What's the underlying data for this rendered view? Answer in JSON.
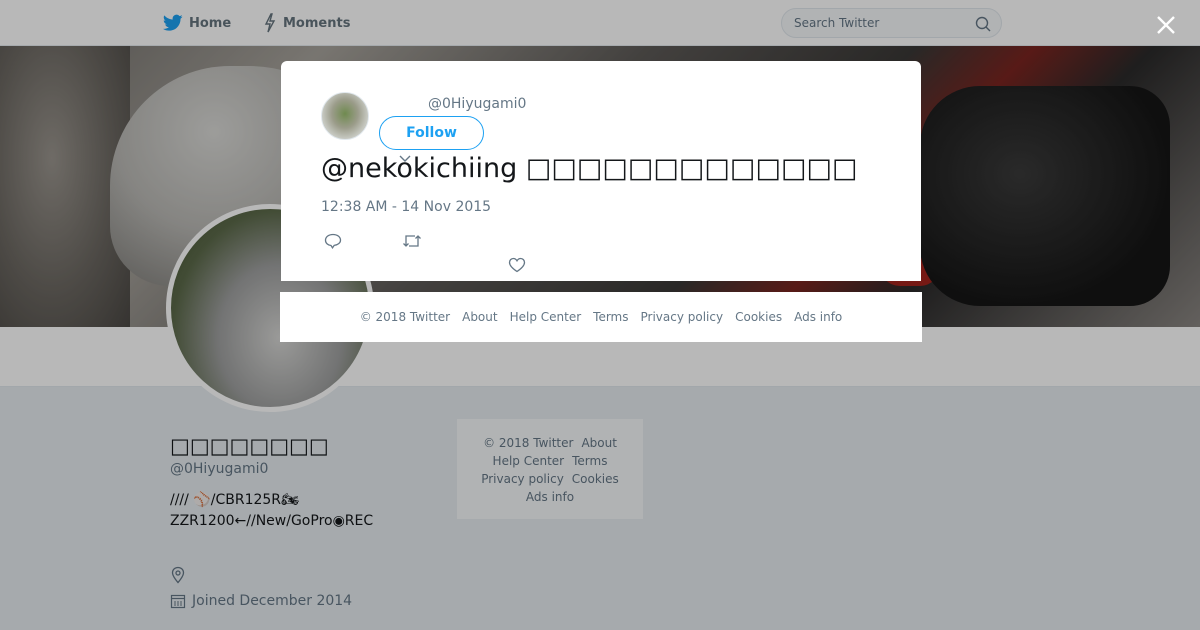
{
  "nav": {
    "home_label": "Home",
    "moments_label": "Moments",
    "search_placeholder": "Search Twitter"
  },
  "profile": {
    "name": "□□□□□□□□",
    "handle": "@0Hiyugami0",
    "bio_line1": "////                    ⚾/CBR125R🏍",
    "bio_line2": "ZZR1200←//New/GoPro◉REC",
    "joined": "Joined December 2014"
  },
  "tweet": {
    "handle": "@0Hiyugami0",
    "follow_label": "Follow",
    "text": "@nekokichiing □□□□□□□□□□□□□",
    "time": "12:38 AM - 14 Nov 2015"
  },
  "footer": {
    "copyright": "© 2018 Twitter",
    "about": "About",
    "help": "Help Center",
    "terms": "Terms",
    "privacy": "Privacy policy",
    "cookies": "Cookies",
    "ads": "Ads info"
  },
  "colors": {
    "accent": "#1da1f2",
    "muted": "#657786",
    "text": "#14171a"
  },
  "icons": {
    "nav_home": "twitter-bird-icon",
    "nav_moments": "lightning-icon",
    "search": "search-icon",
    "close": "close-icon",
    "reply": "reply-icon",
    "retweet": "retweet-icon",
    "like": "heart-icon",
    "location": "location-pin-icon",
    "calendar": "calendar-icon",
    "chevron": "chevron-down-icon"
  }
}
